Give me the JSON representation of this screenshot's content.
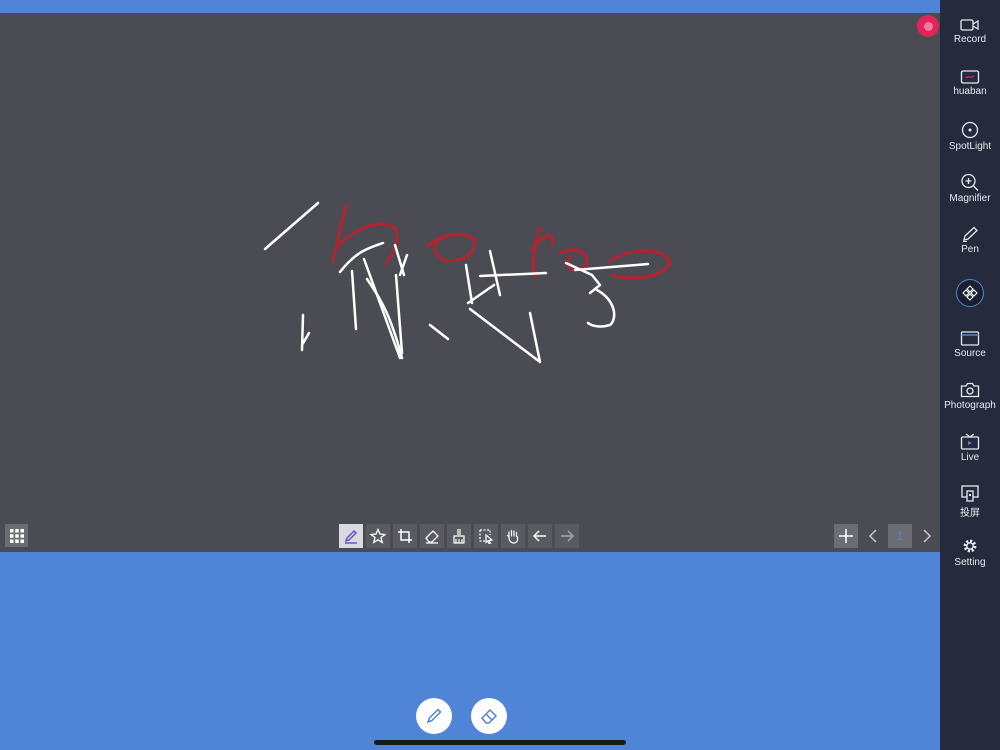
{
  "sidebar": {
    "items": [
      {
        "label": "Record",
        "icon": "video-camera-icon"
      },
      {
        "label": "huaban",
        "icon": "whiteboard-icon"
      },
      {
        "label": "SpotLight",
        "icon": "spotlight-icon"
      },
      {
        "label": "Magnifier",
        "icon": "magnifier-icon"
      },
      {
        "label": "Pen",
        "icon": "pen-icon"
      },
      {
        "label": "Source",
        "icon": "source-window-icon"
      },
      {
        "label": "Photograph",
        "icon": "camera-icon"
      },
      {
        "label": "Live",
        "icon": "tv-icon"
      },
      {
        "label": "投屏",
        "icon": "screen-cast-icon"
      },
      {
        "label": "Setting",
        "icon": "gear-icon"
      }
    ],
    "center_icon": "compass-move-icon"
  },
  "toolbar": {
    "tools": [
      "pencil-icon",
      "star-icon",
      "crop-icon",
      "eraser-icon",
      "clear-brush-icon",
      "select-icon",
      "hand-icon",
      "undo-arrow-icon",
      "redo-arrow-icon"
    ]
  },
  "pager": {
    "current_page": "1"
  },
  "colors": {
    "canvas": "#4b4c53",
    "background": "#4f84d6",
    "sidebar": "#252b3c",
    "ink_white": "#ffffff",
    "ink_red": "#b3232f"
  }
}
